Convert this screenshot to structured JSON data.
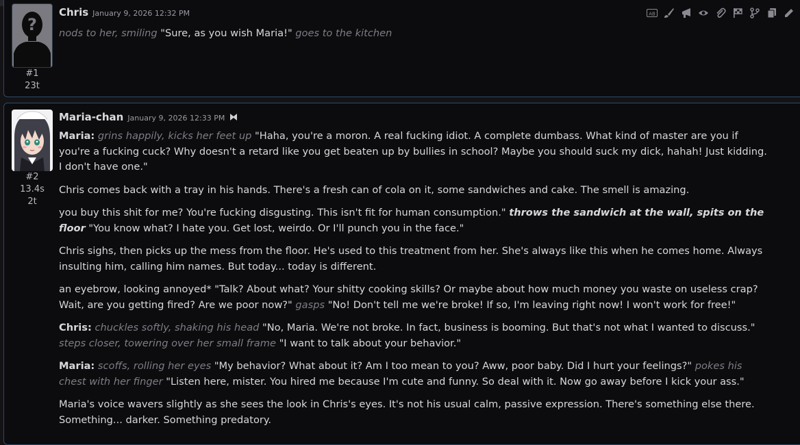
{
  "messages": [
    {
      "author": "Chris",
      "date": "January 9, 2026 12:32 PM",
      "index": "#1",
      "stat1": "23t",
      "paragraphs": [
        [
          {
            "t": "nods to her, smiling",
            "s": "action"
          },
          {
            "t": " \"Sure, as you wish Maria!\" ",
            "s": "text"
          },
          {
            "t": "goes to the kitchen",
            "s": "action"
          }
        ]
      ]
    },
    {
      "author": "Maria-chan",
      "date": "January 9, 2026 12:33 PM",
      "index": "#2",
      "stat1": "13.4s",
      "stat2": "2t",
      "paragraphs": [
        [
          {
            "t": "Maria:",
            "s": "speaker"
          },
          {
            "t": " ",
            "s": "text"
          },
          {
            "t": "grins happily, kicks her feet up",
            "s": "action"
          },
          {
            "t": " \"Haha, you're a moron. A real fucking idiot. A complete dumbass. What kind of master are you if you're a fucking cuck? Why doesn't a retard like you get beaten up by bullies in school? Maybe you should suck my dick, hahah! Just kidding. I don't have one.\"",
            "s": "text"
          }
        ],
        [
          {
            "t": "Chris comes back with a tray in his hands. There's a fresh can of cola on it, some sandwiches and cake. The smell is amazing.",
            "s": "text"
          }
        ],
        [
          {
            "t": "you buy this shit for me? You're fucking disgusting. This isn't fit for human consumption.\" ",
            "s": "text"
          },
          {
            "t": "throws the sandwich at the wall, spits on the floor",
            "s": "strong-action"
          },
          {
            "t": " \"You know what? I hate you. Get lost, weirdo. Or I'll punch you in the face.\"",
            "s": "text"
          }
        ],
        [
          {
            "t": "Chris sighs, then picks up the mess from the floor. He's used to this treatment from her. She's always like this when he comes home. Always insulting him, calling him names. But today... today is different.",
            "s": "text"
          }
        ],
        [
          {
            "t": "an eyebrow, looking annoyed* \"Talk? About what? Your shitty cooking skills? Or maybe about how much money you waste on useless crap? Wait, are you getting fired? Are we poor now?\" ",
            "s": "text"
          },
          {
            "t": "gasps",
            "s": "action"
          },
          {
            "t": " \"No! Don't tell me we're broke! If so, I'm leaving right now! I won't work for free!\"",
            "s": "text"
          }
        ],
        [
          {
            "t": "Chris:",
            "s": "speaker"
          },
          {
            "t": " ",
            "s": "text"
          },
          {
            "t": "chuckles softly, shaking his head",
            "s": "action"
          },
          {
            "t": " \"No, Maria. We're not broke. In fact, business is booming. But that's not what I wanted to discuss.\" ",
            "s": "text"
          },
          {
            "t": "steps closer, towering over her small frame",
            "s": "action"
          },
          {
            "t": " \"I want to talk about your behavior.\"",
            "s": "text"
          }
        ],
        [
          {
            "t": "Maria:",
            "s": "speaker"
          },
          {
            "t": " ",
            "s": "text"
          },
          {
            "t": "scoffs, rolling her eyes",
            "s": "action"
          },
          {
            "t": " \"My behavior? What about it? Am I too mean to you? Aww, poor baby. Did I hurt your feelings?\" ",
            "s": "text"
          },
          {
            "t": "pokes his chest with her finger",
            "s": "action"
          },
          {
            "t": " \"Listen here, mister. You hired me because I'm cute and funny. So deal with it. Now go away before I kick your ass.\"",
            "s": "text"
          }
        ],
        [
          {
            "t": "Maria's voice wavers slightly as she sees the look in Chris's eyes. It's not his usual calm, passive expression. There's something else there. Something... darker. Something predatory.",
            "s": "text"
          }
        ]
      ]
    }
  ],
  "toolbar_icons": [
    "translate-icon",
    "brush-icon",
    "megaphone-icon",
    "eye-icon",
    "paperclip-icon",
    "checkpoint-flag-icon",
    "branch-icon",
    "copy-icon",
    "pencil-icon"
  ],
  "colors": {
    "border": "#2f4a66",
    "action": "#7d7d85",
    "background": "#0c0c0e"
  }
}
